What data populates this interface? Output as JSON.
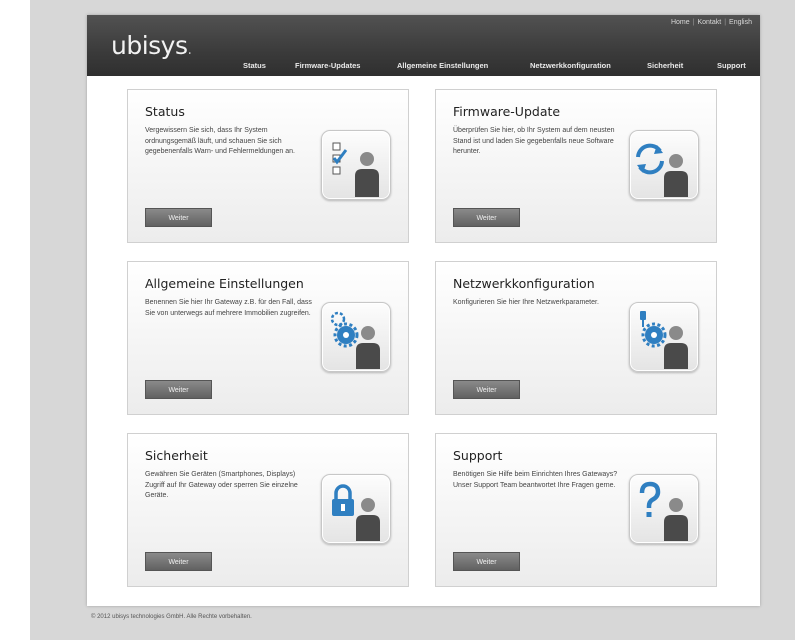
{
  "header": {
    "logo_text": "ubisys",
    "logo_dot": ".",
    "top_links": [
      "Home",
      "Kontakt",
      "English"
    ],
    "nav": [
      "Status",
      "Firmware-Updates",
      "Allgemeine Einstellungen",
      "Netzwerkkonfiguration",
      "Sicherheit",
      "Support"
    ]
  },
  "cards": [
    {
      "title": "Status",
      "text": "Vergewissern Sie sich, dass Ihr System ordnungsgemäß läuft, und schauen Sie sich gegebenenfalls Warn- und Fehlermeldungen an.",
      "button": "Weiter",
      "icon": "checklist-user-icon"
    },
    {
      "title": "Firmware-Update",
      "text": "Überprüfen Sie hier, ob Ihr System auf dem neusten Stand ist und laden Sie gegebenfalls neue Software herunter.",
      "button": "Weiter",
      "icon": "refresh-user-icon"
    },
    {
      "title": "Allgemeine Einstellungen",
      "text": "Benennen Sie hier Ihr Gateway z.B. für den Fall, dass Sie von unterwegs auf mehrere Immobilien zugreifen.",
      "button": "Weiter",
      "icon": "gear-user-icon"
    },
    {
      "title": "Netzwerkkonfiguration",
      "text": "Konfigurieren Sie hier Ihre Netzwerkparameter.",
      "button": "Weiter",
      "icon": "network-gear-user-icon"
    },
    {
      "title": "Sicherheit",
      "text": "Gewähren Sie Geräten (Smartphones, Displays) Zugriff auf Ihr Gateway oder sperren Sie einzelne Geräte.",
      "button": "Weiter",
      "icon": "lock-user-icon"
    },
    {
      "title": "Support",
      "text": "Benötigen Sie Hilfe beim Einrichten Ihres Gateways? Unser Support Team beantwortet Ihre Fragen gerne.",
      "button": "Weiter",
      "icon": "question-user-icon"
    }
  ],
  "footer": "© 2012 ubisys technologies GmbH. Alle Rechte vorbehalten.",
  "colors": {
    "header": "#3b3b3b",
    "button": "#6e6e6e",
    "icon_blue": "#2f7fc1"
  }
}
